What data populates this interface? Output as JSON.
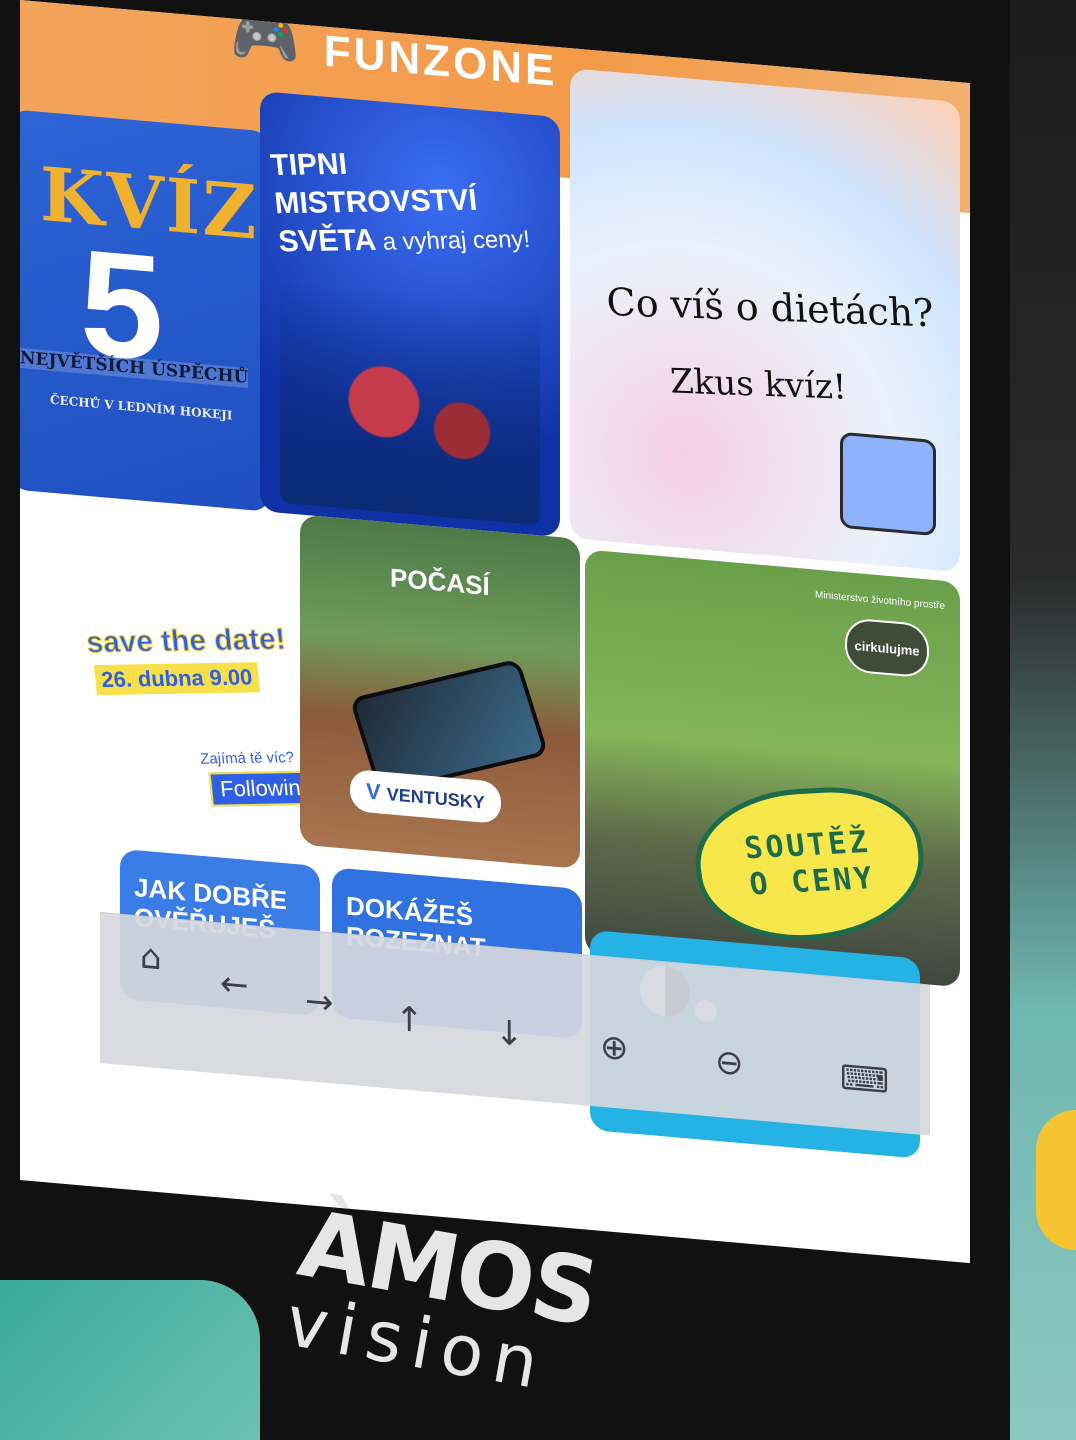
{
  "header": {
    "title": "FUNZONE",
    "icon": "gamepad-icon"
  },
  "tiles": {
    "kviz": {
      "title": "KVÍZ",
      "number": "5",
      "line1": "NEJVĚTŠÍCH ÚSPĚCHŮ",
      "line2": "ČECHŮ V LEDNÍM HOKEJI"
    },
    "tipni": {
      "line1": "TIPNI MISTROVSTVÍ",
      "line2_bold": "SVĚTA",
      "line2_rest": " a vyhraj ceny!"
    },
    "dieta": {
      "question": "Co víš o dietách?",
      "cta": "Zkus kvíz!"
    },
    "save": {
      "stamp": "save the date!",
      "date": "26. dubna 9.00",
      "question": "Zajímá tě víc?",
      "follow": "Following"
    },
    "pocasi": {
      "title": "POČASÍ",
      "badge": "VENTUSKY"
    },
    "soutez": {
      "ministry": "Ministerstvo životního prostře",
      "logo": "cirkulujme",
      "line1": "SOUTĚŽ",
      "line2": "O CENY"
    },
    "jak": {
      "line1": "JAK DOBŘE",
      "line2": "OVĚŘUJEŠ"
    },
    "dokazes": {
      "line1": "DOKÁŽEŠ",
      "line2": "ROZEZNAT"
    }
  },
  "navbar": {
    "home": "⌂",
    "back": "←",
    "forward": "→",
    "up": "↑",
    "down": "↓",
    "zoom_in": "⊕",
    "zoom_out": "⊖",
    "keyboard": "⌨"
  },
  "brand": {
    "top": "ÀMOS",
    "bottom": "vision"
  }
}
